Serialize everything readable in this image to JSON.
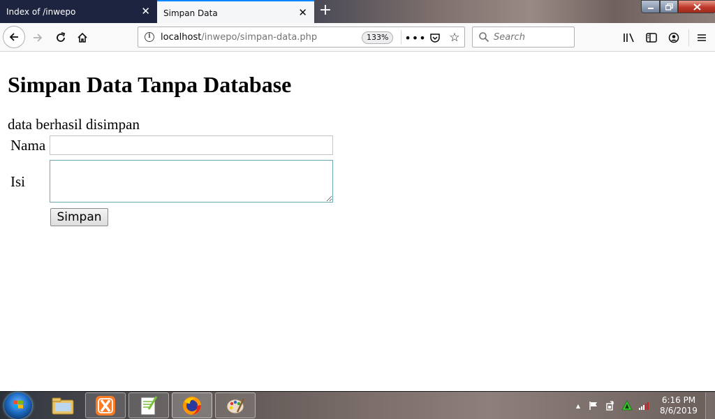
{
  "browser": {
    "tabs": [
      {
        "title": "Index of /inwepo",
        "active": false
      },
      {
        "title": "Simpan Data",
        "active": true
      }
    ],
    "new_tab_label": "+",
    "url_host": "localhost",
    "url_path": "/inwepo/simpan-data.php",
    "zoom": "133%",
    "search_placeholder": "Search"
  },
  "page": {
    "title": "Simpan Data Tanpa Database",
    "status_message": "data berhasil disimpan",
    "form": {
      "nama_label": "Nama",
      "nama_value": "",
      "isi_label": "Isi",
      "isi_value": "",
      "submit_label": "Simpan"
    }
  },
  "taskbar": {
    "apps": [
      "windows-explorer",
      "xampp-control-panel",
      "notepad-plus-plus",
      "firefox",
      "paint"
    ],
    "clock_time": "6:16 PM",
    "clock_date": "8/6/2019"
  },
  "colors": {
    "tab_strip": "#1c2440",
    "active_tab": "#f5f6f7",
    "active_tab_accent": "#0a84ff",
    "toolbar": "#f9f9fa",
    "page_background": "#ffffff"
  }
}
